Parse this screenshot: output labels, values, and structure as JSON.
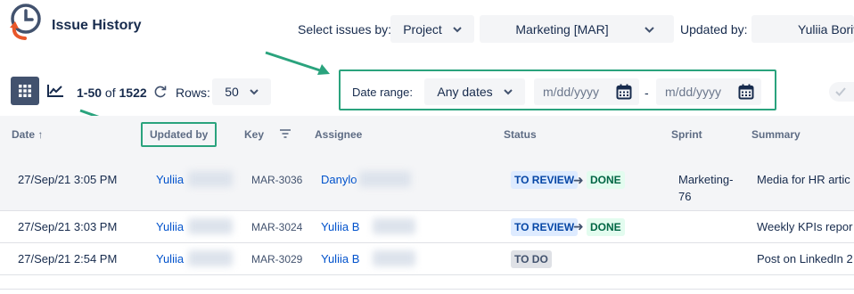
{
  "header": {
    "title": "Issue History",
    "select_label": "Select issues by:",
    "select_by": "Project",
    "project": "Marketing [MAR]",
    "updated_by_label": "Updated by:",
    "updated_by_value": "Yuliia Boriv"
  },
  "toolbar": {
    "range_start": "1-50",
    "of": "of",
    "total": "1522",
    "rows_label": "Rows:",
    "rows_value": "50",
    "date_range_label": "Date range:",
    "date_range_value": "Any dates",
    "from_placeholder": "m/dd/yyyy",
    "dash": "-",
    "to_placeholder": "m/dd/yyyy"
  },
  "columns": {
    "date": "Date",
    "date_sort": "↑",
    "updated_by": "Updated by",
    "key": "Key",
    "assignee": "Assignee",
    "status": "Status",
    "sprint": "Sprint",
    "summary": "Summary"
  },
  "rows": [
    {
      "date": "27/Sep/21 3:05 PM",
      "updated_by": "Yuliia",
      "key": "MAR-3036",
      "assignee": "Danylo",
      "status_from": "TO REVIEW",
      "status_to": "DONE",
      "sprint_line1": "Marketing-",
      "sprint_line2": "76",
      "summary": "Media for HR artic"
    },
    {
      "date": "27/Sep/21 3:03 PM",
      "updated_by": "Yuliia",
      "key": "MAR-3024",
      "assignee": "Yuliia B",
      "status_from": "TO REVIEW",
      "status_to": "DONE",
      "summary": "Weekly KPIs repor"
    },
    {
      "date": "27/Sep/21 2:54 PM",
      "updated_by": "Yuliia",
      "key": "MAR-3029",
      "assignee": "Yuliia B",
      "status_from": "TO DO",
      "summary": "Post on LinkedIn 2"
    }
  ],
  "colors": {
    "highlight": "#2aa37d",
    "link": "#0052cc",
    "logo_blue": "#42526e",
    "logo_orange": "#e8572a"
  }
}
